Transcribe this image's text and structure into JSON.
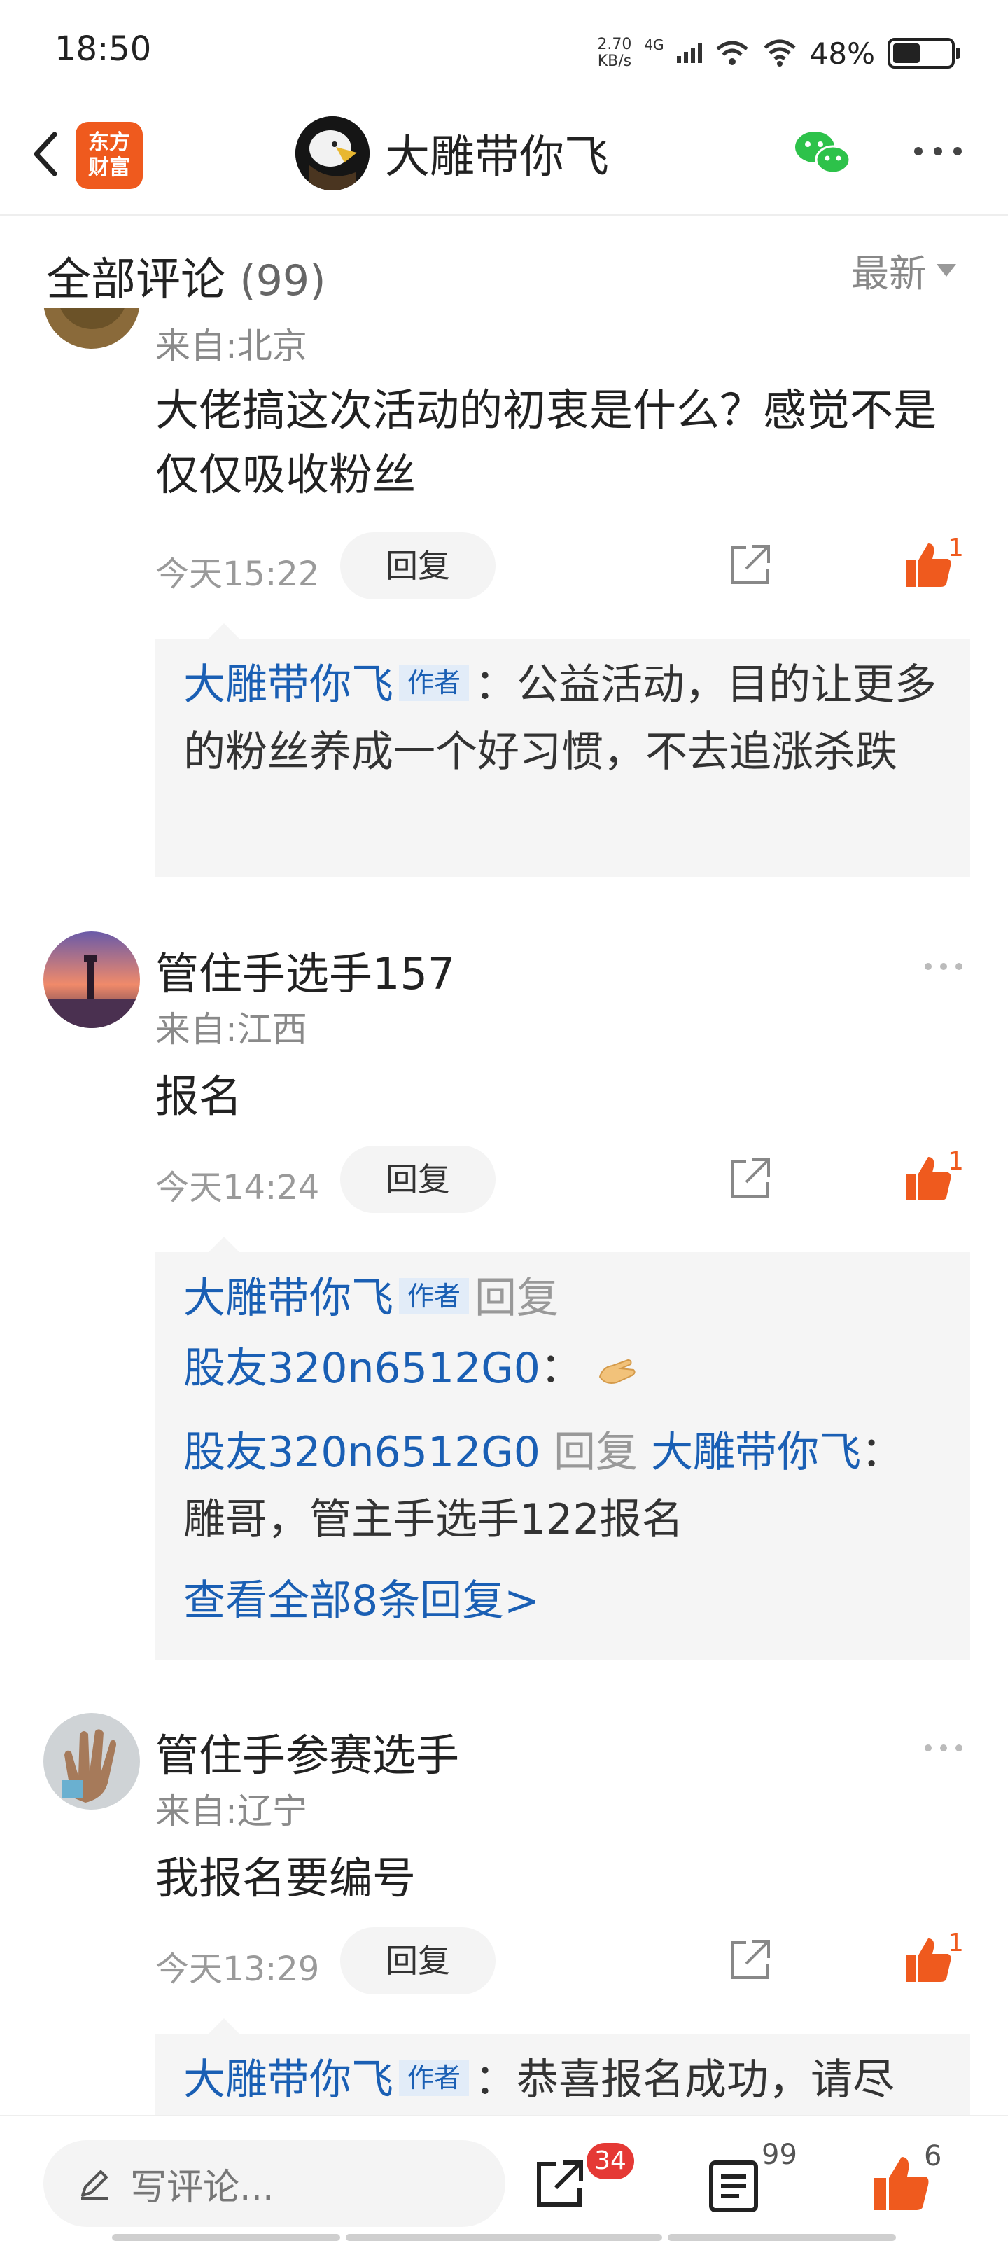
{
  "status_bar": {
    "time": "18:50",
    "net_speed_value": "2.70",
    "net_speed_unit": "KB/s",
    "signal_type": "4G",
    "battery_pct": "48%",
    "battery_level": 0.48
  },
  "nav": {
    "logo_line1": "东方",
    "logo_line2": "财富",
    "title": "大雕带你飞"
  },
  "section": {
    "title": "全部评论",
    "count": "(99)",
    "sort_label": "最新"
  },
  "comments": [
    {
      "from": "来自:北京",
      "text": "大佬搞这次活动的初衷是什么？感觉不是仅仅吸收粉丝",
      "time": "今天15:22",
      "reply_label": "回复",
      "likes": "1",
      "replies": {
        "author": "大雕带你飞",
        "author_tag": "作者",
        "text": "：公益活动，目的让更多的粉丝养成一个好习惯，不去追涨杀跌"
      }
    },
    {
      "name": "管住手选手157",
      "from": "来自:江西",
      "text": "报名",
      "time": "今天14:24",
      "reply_label": "回复",
      "likes": "1",
      "replies": {
        "line1_author": "大雕带你飞",
        "line1_tag": "作者",
        "line1_action": "回复",
        "line2_user": "股友320n6512G0",
        "line2_sep": "：",
        "line3_user": "股友320n6512G0",
        "line3_action": "回复",
        "line3_target": "大雕带你飞",
        "line3_sep": "：",
        "line4_text": "雕哥，管主手选手122报名",
        "view_all": "查看全部8条回复>"
      }
    },
    {
      "name": "管住手参赛选手",
      "from": "来自:辽宁",
      "text": "我报名要编号",
      "time": "今天13:29",
      "reply_label": "回复",
      "likes": "1",
      "replies": {
        "author": "大雕带你飞",
        "author_tag": "作者",
        "text": "：恭喜报名成功，请尽"
      }
    }
  ],
  "bottom_bar": {
    "input_placeholder": "写评论...",
    "share_badge": "34",
    "comments_count": "99",
    "likes_count": "6"
  },
  "colors": {
    "accent_orange": "#ef5a1e",
    "link_blue": "#1a5fb4",
    "badge_red": "#e53935"
  }
}
